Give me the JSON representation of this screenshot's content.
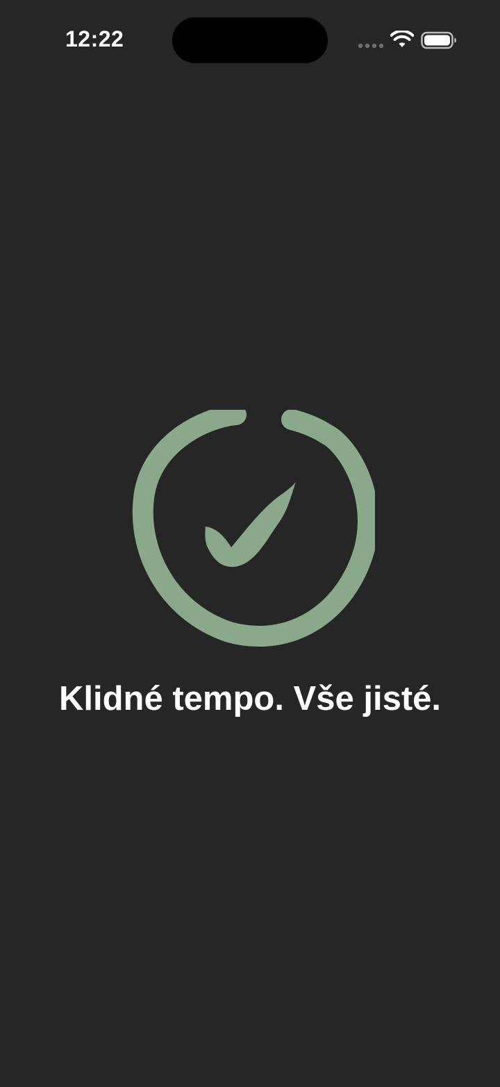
{
  "status_bar": {
    "time": "12:22",
    "icons": [
      "cellular-signal-icon",
      "wifi-icon",
      "battery-icon"
    ]
  },
  "main": {
    "message": "Klidné tempo. Vše jisté."
  },
  "graphic": {
    "icon": "check-circle-icon",
    "color": "#8aa98b"
  },
  "colors": {
    "background": "#262626",
    "text": "#ffffff"
  }
}
